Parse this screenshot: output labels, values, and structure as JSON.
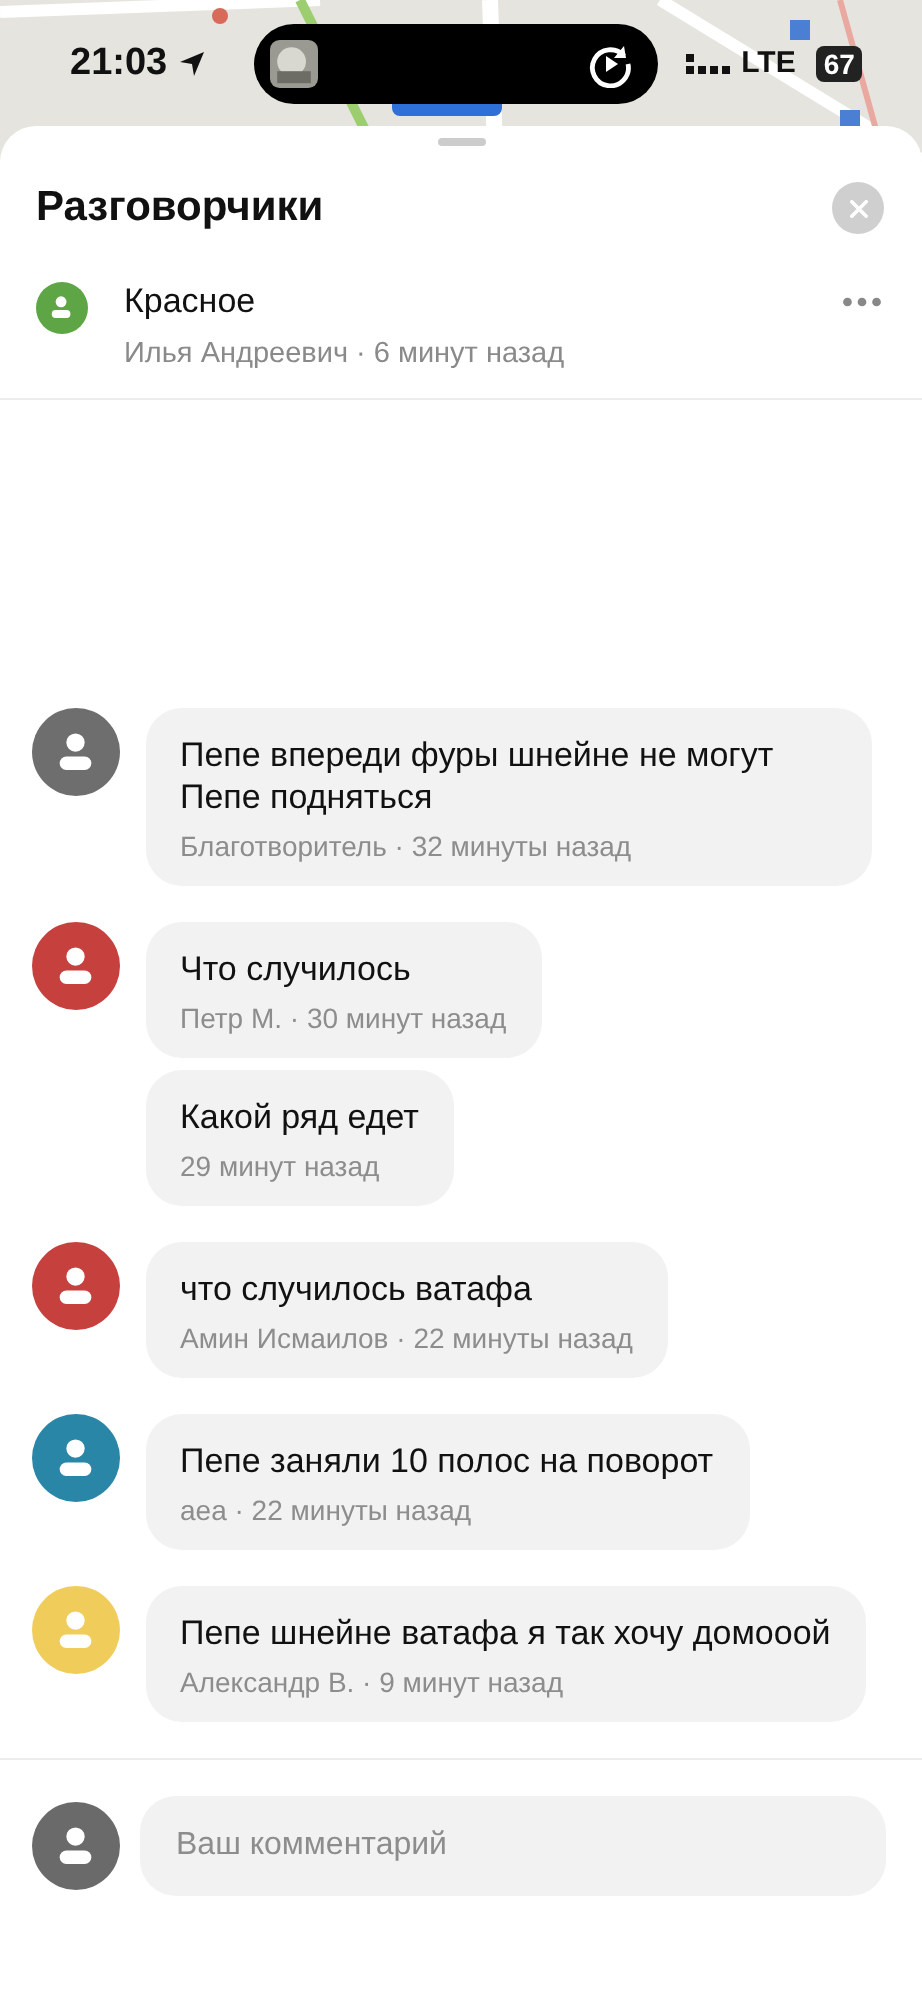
{
  "status_bar": {
    "time": "21:03",
    "network": "LTE",
    "battery": "67"
  },
  "sheet": {
    "title": "Разговорчики"
  },
  "post": {
    "title": "Красное",
    "meta": "Илья Андреевич · 6 минут назад"
  },
  "messages": [
    {
      "kind": "with_avatar",
      "color": "#6e6e6e",
      "text": "Пепе впереди фуры шнейне не могут Пепе подняться",
      "meta": "Благотворитель · 32 минуты назад"
    },
    {
      "kind": "with_avatar",
      "color": "#c6403e",
      "text": "Что случилось",
      "meta": "Петр М. · 30 минут назад"
    },
    {
      "kind": "continuation",
      "text": "Какой ряд едет",
      "meta": "29 минут назад"
    },
    {
      "kind": "with_avatar",
      "color": "#c6403e",
      "text": "что случилось ватафа",
      "meta": "Амин Исмаилов · 22 минуты назад"
    },
    {
      "kind": "with_avatar",
      "color": "#2a86a6",
      "text": "Пепе заняли 10 полос на поворот",
      "meta": "аеа · 22 минуты назад"
    },
    {
      "kind": "with_avatar",
      "color": "#f0cd5a",
      "text": "Пепе шнейне ватафа я так хочу домооой",
      "meta": "Александр В. · 9 минут назад"
    }
  ],
  "compose": {
    "placeholder": "Ваш комментарий"
  }
}
